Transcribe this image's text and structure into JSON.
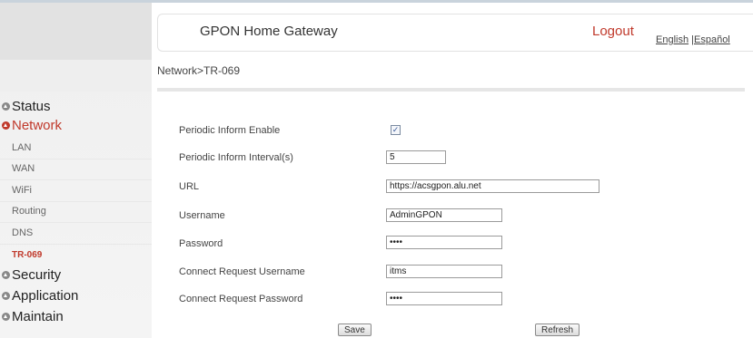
{
  "header": {
    "title": "GPON Home Gateway",
    "logout": "Logout",
    "lang_english": "English",
    "lang_separator": "|",
    "lang_spanish": "Español"
  },
  "breadcrumb": "Network>TR-069",
  "sidebar": {
    "status": "Status",
    "network": "Network",
    "items": [
      "LAN",
      "WAN",
      "WiFi",
      "Routing",
      "DNS",
      "TR-069"
    ],
    "security": "Security",
    "application": "Application",
    "maintain": "Maintain"
  },
  "form": {
    "periodic_inform_enable": {
      "label": "Periodic Inform Enable",
      "checked": true
    },
    "periodic_inform_interval": {
      "label": "Periodic Inform Interval(s)",
      "value": "5"
    },
    "url": {
      "label": "URL",
      "value": "https://acsgpon.alu.net"
    },
    "username": {
      "label": "Username",
      "value": "AdminGPON"
    },
    "password": {
      "label": "Password",
      "value": "••••"
    },
    "connect_request_username": {
      "label": "Connect Request Username",
      "value": "itms"
    },
    "connect_request_password": {
      "label": "Connect Request Password",
      "value": "••••"
    }
  },
  "buttons": {
    "save": "Save",
    "refresh": "Refresh"
  },
  "colors": {
    "accent": "#c0392b",
    "sidebar_bg": "#efefef"
  }
}
